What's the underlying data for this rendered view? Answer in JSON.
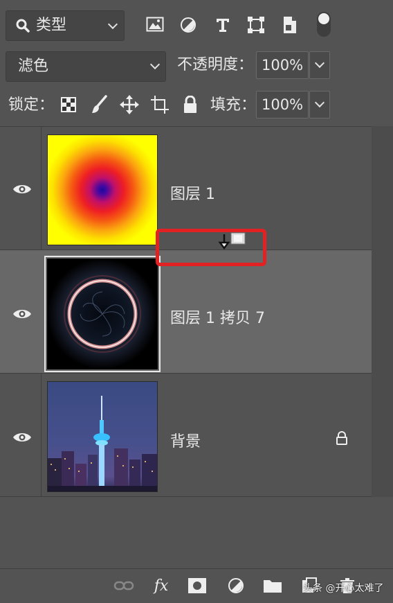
{
  "filter": {
    "kind_label": "类型"
  },
  "blend": {
    "mode": "滤色",
    "opacity_label": "不透明度：",
    "opacity_value": "100%"
  },
  "lock": {
    "label": "锁定：",
    "fill_label": "填充：",
    "fill_value": "100%"
  },
  "layers": [
    {
      "name": "图层 1",
      "visible": true,
      "selected": false
    },
    {
      "name": "图层 1 拷贝 7",
      "visible": true,
      "selected": true
    },
    {
      "name": "背景",
      "visible": true,
      "selected": false,
      "locked": true
    }
  ],
  "watermark": "头条 @开心太难了",
  "colors": {
    "panel": "#535353",
    "selected": "#686868",
    "highlight": "#e22222"
  },
  "icons": [
    "search-icon",
    "image-filter-icon",
    "adjustment-filter-icon",
    "type-filter-icon",
    "shape-filter-icon",
    "smart-object-filter-icon",
    "filter-toggle-icon",
    "lock-transparent-icon",
    "lock-paint-icon",
    "lock-move-icon",
    "lock-artboard-icon",
    "lock-all-icon",
    "link-icon",
    "fx-icon",
    "mask-icon",
    "adjustment-layer-icon",
    "folder-icon",
    "trash-icon"
  ]
}
